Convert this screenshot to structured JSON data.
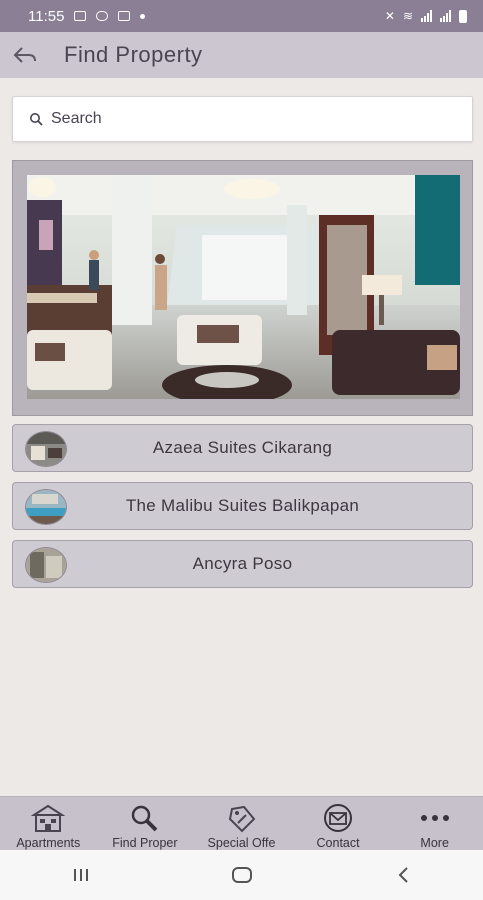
{
  "status_bar": {
    "time": "11:55"
  },
  "header": {
    "title": "Find Property"
  },
  "search": {
    "placeholder": "Search"
  },
  "properties": [
    {
      "name": "Azaea Suites Cikarang"
    },
    {
      "name": "The Malibu Suites Balikpapan"
    },
    {
      "name": "Ancyra Poso"
    }
  ],
  "bottom_nav": [
    {
      "label": "Apartments",
      "icon": "building-icon"
    },
    {
      "label": "Find Proper",
      "icon": "search-icon"
    },
    {
      "label": "Special Offe",
      "icon": "tag-icon"
    },
    {
      "label": "Contact",
      "icon": "mail-icon"
    },
    {
      "label": "More",
      "icon": "more-icon"
    }
  ],
  "colors": {
    "status_bar": "#8A7F94",
    "header": "#CBC6D0",
    "background": "#ECE9E6",
    "list_item": "#CFCBD2",
    "bottom_nav": "#C6C1CB"
  }
}
